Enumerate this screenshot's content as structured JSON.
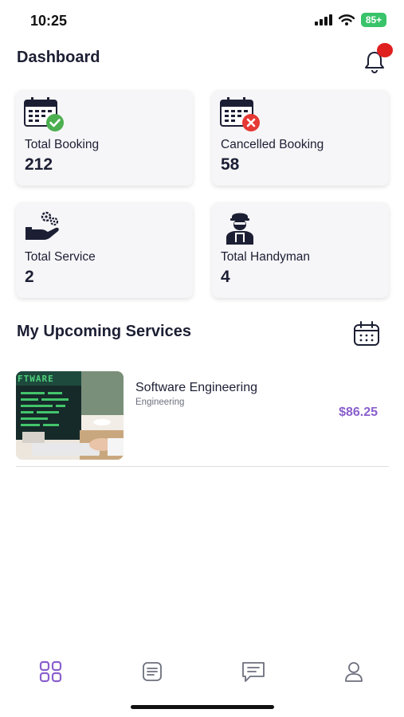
{
  "status_bar": {
    "time": "10:25",
    "battery": "85+"
  },
  "header": {
    "title": "Dashboard",
    "icon": "bell-icon"
  },
  "stats": [
    {
      "label": "Total Booking",
      "value": "212",
      "icon": "calendar-check-icon"
    },
    {
      "label": "Cancelled Booking",
      "value": "58",
      "icon": "calendar-cancel-icon"
    },
    {
      "label": "Total Service",
      "value": "2",
      "icon": "hand-gears-icon"
    },
    {
      "label": "Total Handyman",
      "value": "4",
      "icon": "handyman-icon"
    }
  ],
  "upcoming": {
    "title": "My Upcoming Services",
    "services": [
      {
        "name": "Software Engineering",
        "category": "Engineering",
        "price": "$86.25",
        "thumb_text": "FTWARE"
      }
    ]
  },
  "colors": {
    "accent": "#8a5fcc",
    "text": "#1c1f34",
    "card_bg": "#f6f6f8",
    "success": "#4caf50",
    "danger": "#e53935",
    "notification": "#e01f1f"
  },
  "nav": [
    {
      "icon": "grid-icon",
      "active": true
    },
    {
      "icon": "list-icon",
      "active": false
    },
    {
      "icon": "chat-icon",
      "active": false
    },
    {
      "icon": "profile-icon",
      "active": false
    }
  ]
}
